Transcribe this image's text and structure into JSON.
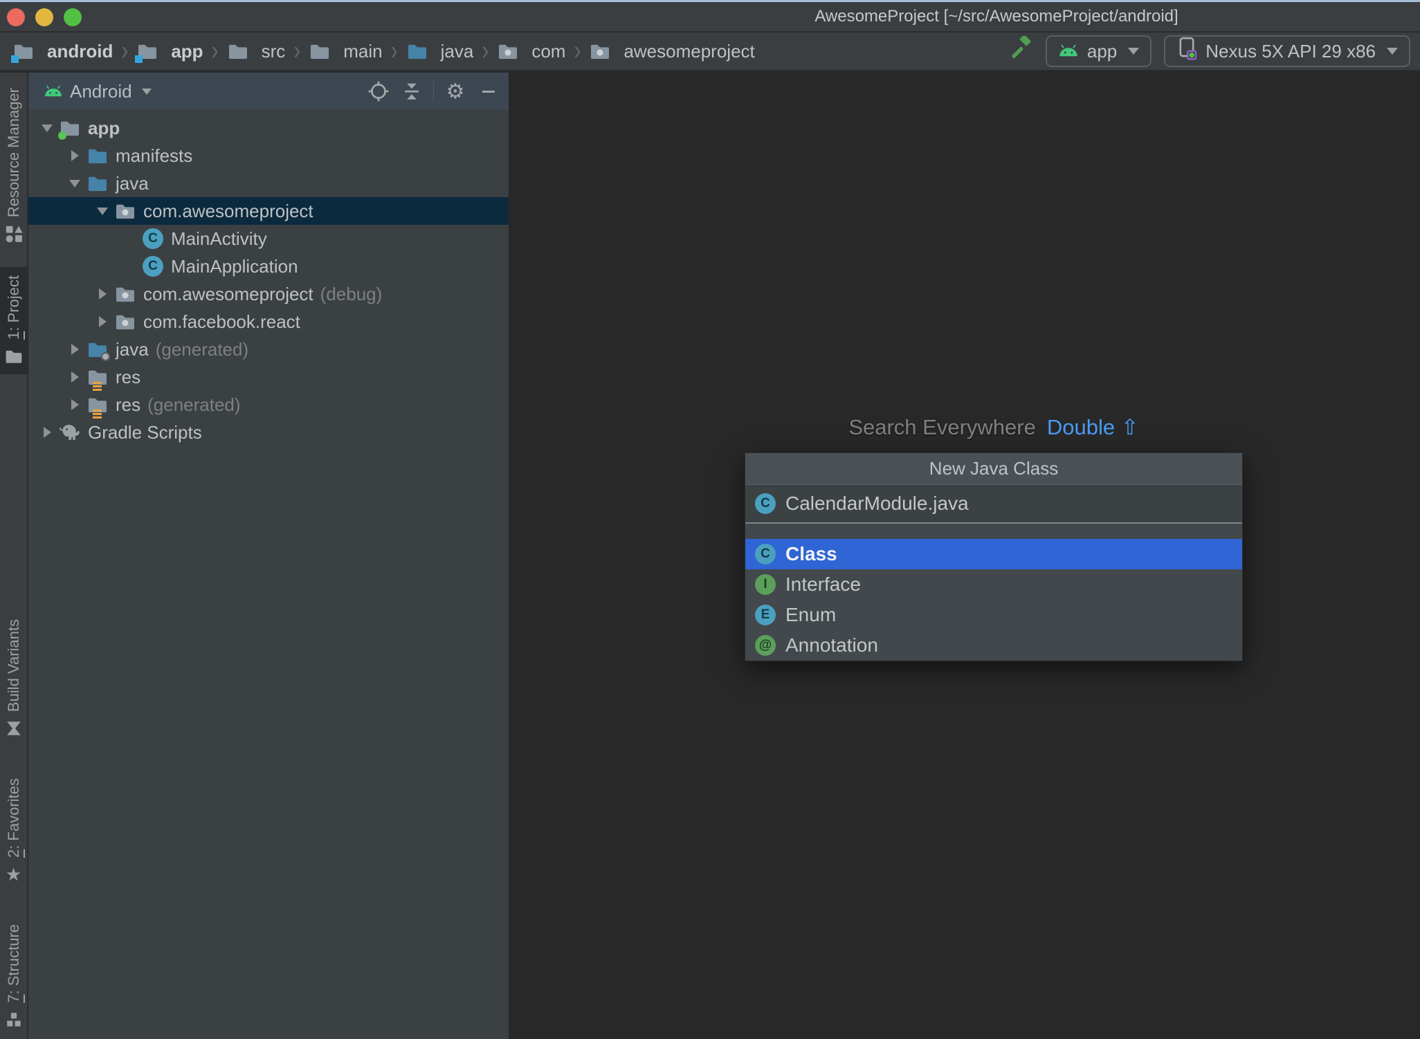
{
  "window": {
    "title": "AwesomeProject [~/src/AwesomeProject/android]"
  },
  "toolbar": {
    "breadcrumbs": [
      {
        "label": "android",
        "icon": "module",
        "bold": true
      },
      {
        "label": "app",
        "icon": "module",
        "bold": true
      },
      {
        "label": "src",
        "icon": "folder"
      },
      {
        "label": "main",
        "icon": "folder"
      },
      {
        "label": "java",
        "icon": "folder-blue"
      },
      {
        "label": "com",
        "icon": "package"
      },
      {
        "label": "awesomeproject",
        "icon": "package"
      }
    ],
    "build_icon": "hammer-icon",
    "run_config": "app",
    "device": "Nexus 5X API 29 x86"
  },
  "tool_stripe": {
    "top": [
      {
        "key": "",
        "label": "Resource Manager",
        "icon": "resource-manager",
        "active": false
      },
      {
        "key": "1",
        "label": ": Project",
        "icon": "project",
        "active": true
      }
    ],
    "bottom": [
      {
        "key": "",
        "label": "Build Variants",
        "icon": "build-variants",
        "active": false
      },
      {
        "key": "2",
        "label": ": Favorites",
        "icon": "favorites",
        "active": false
      },
      {
        "key": "7",
        "label": ": Structure",
        "icon": "structure",
        "active": false
      }
    ]
  },
  "project_panel": {
    "view_selector": "Android",
    "header_icons": [
      "locate",
      "collapse-all",
      "settings",
      "hide"
    ],
    "tree": [
      {
        "label": "app",
        "bold": true,
        "icon": "module-folder",
        "arrow": "expanded",
        "indent": 0
      },
      {
        "label": "manifests",
        "icon": "folder-blue",
        "arrow": "collapsed",
        "indent": 1
      },
      {
        "label": "java",
        "icon": "folder-blue",
        "arrow": "expanded",
        "indent": 1
      },
      {
        "label": "com.awesomeproject",
        "icon": "package",
        "arrow": "expanded",
        "indent": 2,
        "selected": true
      },
      {
        "label": "MainActivity",
        "icon": "class",
        "arrow": "none",
        "indent": 3
      },
      {
        "label": "MainApplication",
        "icon": "class",
        "arrow": "none",
        "indent": 3
      },
      {
        "label": "com.awesomeproject",
        "suffix": "(debug)",
        "icon": "package",
        "arrow": "collapsed",
        "indent": 2
      },
      {
        "label": "com.facebook.react",
        "icon": "package",
        "arrow": "collapsed",
        "indent": 2
      },
      {
        "label": "java",
        "suffix": "(generated)",
        "icon": "folder-generated",
        "arrow": "collapsed",
        "indent": 1
      },
      {
        "label": "res",
        "icon": "folder-res",
        "arrow": "collapsed",
        "indent": 1
      },
      {
        "label": "res",
        "suffix": "(generated)",
        "icon": "folder-res",
        "arrow": "collapsed",
        "indent": 1
      },
      {
        "label": "Gradle Scripts",
        "icon": "gradle",
        "arrow": "collapsed",
        "indent": 0
      }
    ]
  },
  "editor": {
    "hint": "Search Everywhere",
    "shortcut": "Double ⇧"
  },
  "popup": {
    "title": "New Java Class",
    "name_value": "CalendarModule.java",
    "items": [
      {
        "label": "Class",
        "letter": "C",
        "style": "teal",
        "selected": true
      },
      {
        "label": "Interface",
        "letter": "I",
        "style": "green",
        "selected": false
      },
      {
        "label": "Enum",
        "letter": "E",
        "style": "teal",
        "selected": false
      },
      {
        "label": "Annotation",
        "letter": "@",
        "style": "green",
        "selected": false
      }
    ]
  },
  "colors": {
    "selection_blue": "#2F65D4",
    "tree_selection_navy": "#0C2A3E",
    "link_blue": "#4A9BF5",
    "editor_bg": "#282828",
    "panel_bg": "#3B4043",
    "bar_bg": "#3B3E40",
    "panel_header_bg": "#3D4752",
    "android_green": "#41C97B",
    "traffic_red": "#ED6A5E",
    "traffic_yellow": "#E1B73F",
    "traffic_green": "#53C043"
  }
}
